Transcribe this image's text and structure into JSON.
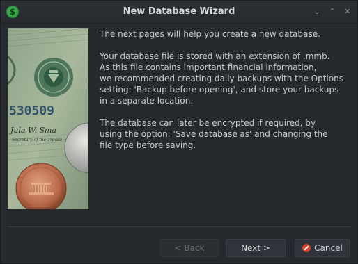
{
  "window": {
    "title": "New Database Wizard",
    "app_icon_glyph": "$",
    "controls": {
      "minimize": "⌄",
      "maximize": "⌃",
      "close": "✕"
    }
  },
  "content": {
    "paragraphs": [
      "The next pages will help you create a new database.",
      "Your database file is stored with an extension of .mmb.\nAs this file contains important financial information,\nwe recommended creating daily backups with the Options\nsetting: 'Backup before opening', and store your backups\nin a separate location.",
      "The database can later be encrypted if required, by\nusing the option: 'Save database as' and changing the\nfile type before saving."
    ]
  },
  "buttons": {
    "back": "< Back",
    "next": "Next >",
    "cancel": "Cancel"
  },
  "image": {
    "serial_text": "530509",
    "signature_text": "Jula W. Sma",
    "caption_text": "Secretary of the Treasu"
  },
  "colors": {
    "accent_green": "#3aa84a",
    "cancel_red": "#d9412e"
  }
}
